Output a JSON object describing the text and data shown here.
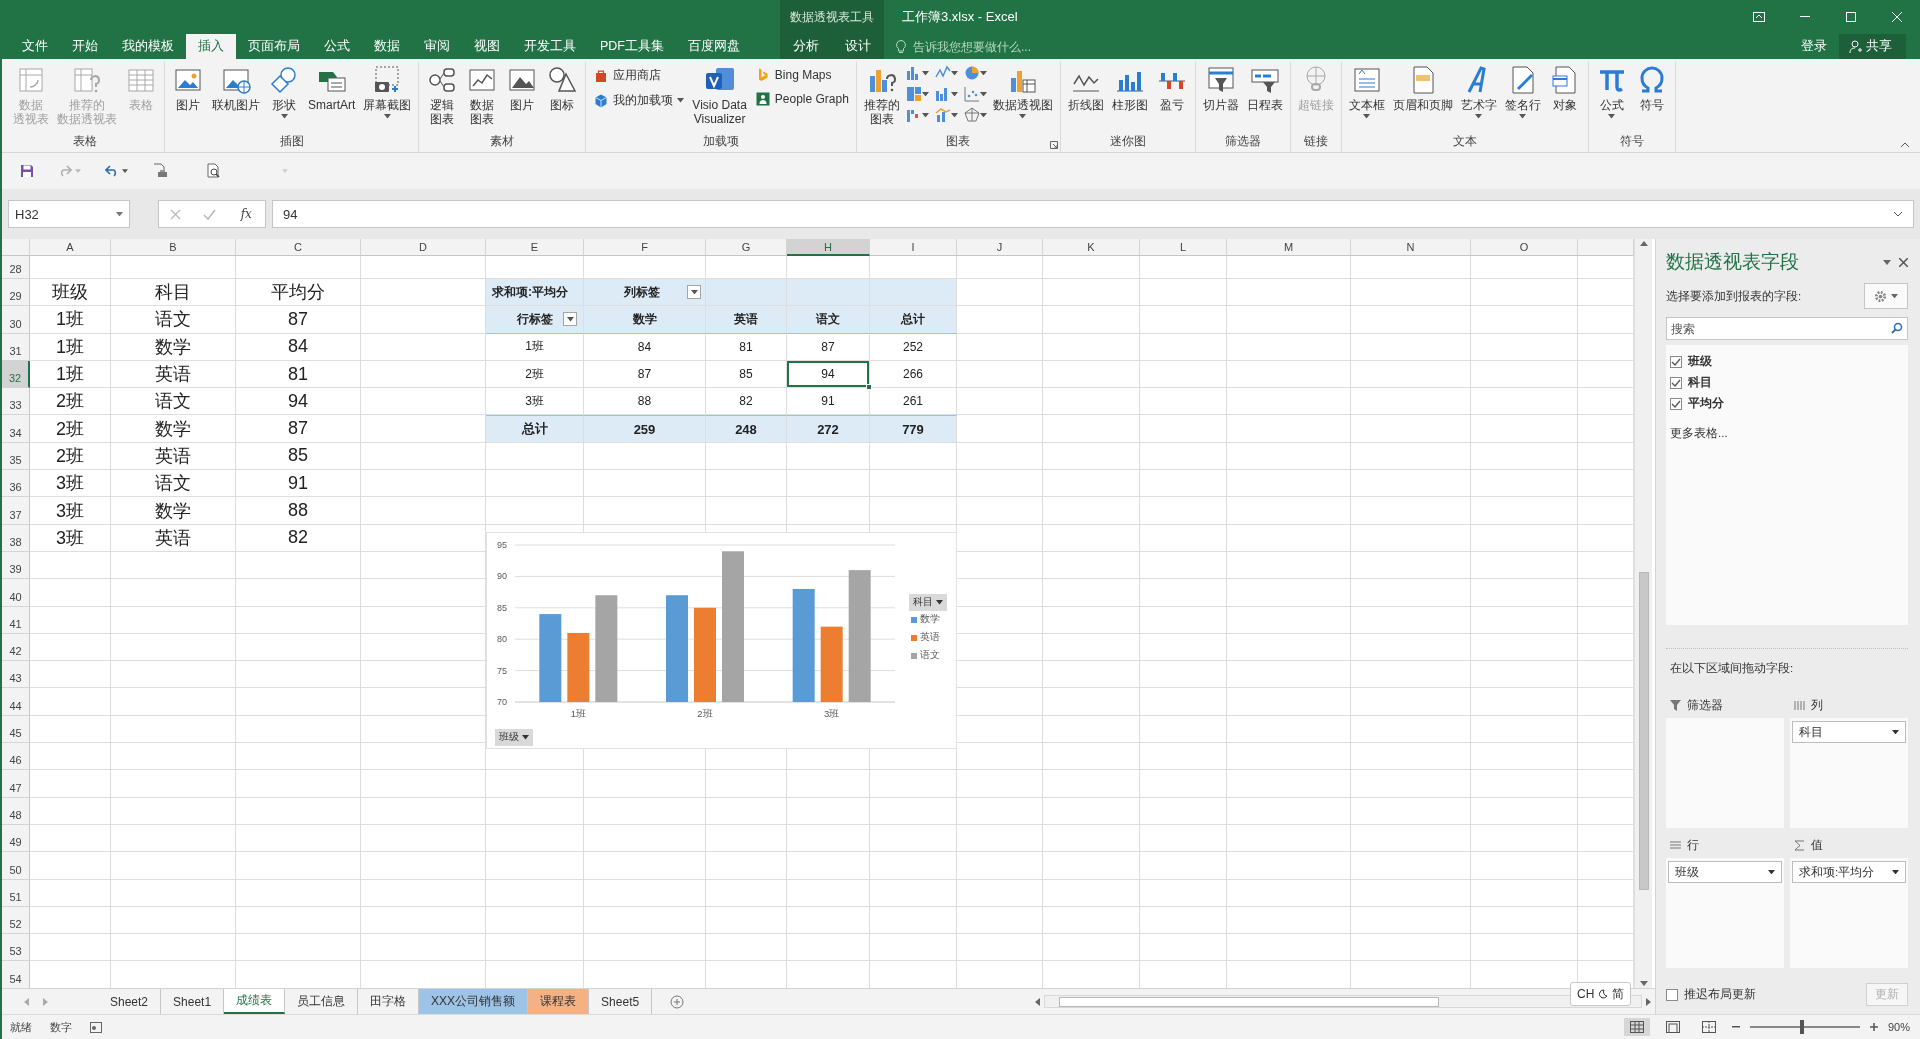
{
  "title_bar": {
    "context_label": "数据透视表工具",
    "title": "工作簿3.xlsx - Excel"
  },
  "menu_tabs": [
    {
      "label": "文件",
      "selected": false,
      "kind": "normal"
    },
    {
      "label": "开始",
      "selected": false,
      "kind": "normal"
    },
    {
      "label": "我的模板",
      "selected": false,
      "kind": "normal"
    },
    {
      "label": "插入",
      "selected": true,
      "kind": "normal"
    },
    {
      "label": "页面布局",
      "selected": false,
      "kind": "normal"
    },
    {
      "label": "公式",
      "selected": false,
      "kind": "normal"
    },
    {
      "label": "数据",
      "selected": false,
      "kind": "normal"
    },
    {
      "label": "审阅",
      "selected": false,
      "kind": "normal"
    },
    {
      "label": "视图",
      "selected": false,
      "kind": "normal"
    },
    {
      "label": "开发工具",
      "selected": false,
      "kind": "normal"
    },
    {
      "label": "PDF工具集",
      "selected": false,
      "kind": "normal"
    },
    {
      "label": "百度网盘",
      "selected": false,
      "kind": "normal"
    },
    {
      "label": "分析",
      "selected": false,
      "kind": "context"
    },
    {
      "label": "设计",
      "selected": false,
      "kind": "context"
    }
  ],
  "tell_me": {
    "placeholder": "告诉我您想要做什么..."
  },
  "account": {
    "login": "登录",
    "share": "共享"
  },
  "ribbon_groups": [
    {
      "label": "表格",
      "launcher": false,
      "items": [
        {
          "kind": "large",
          "lines": [
            "数据",
            "透视表"
          ],
          "disabled": true,
          "dropdown": false
        },
        {
          "kind": "large",
          "lines": [
            "推荐的",
            "数据透视表"
          ],
          "disabled": true,
          "dropdown": false
        },
        {
          "kind": "large",
          "lines": [
            "表格"
          ],
          "disabled": true,
          "dropdown": false
        }
      ]
    },
    {
      "label": "插图",
      "launcher": false,
      "items": [
        {
          "kind": "large",
          "lines": [
            "图片"
          ],
          "disabled": false,
          "dropdown": false
        },
        {
          "kind": "large",
          "lines": [
            "联机图片"
          ],
          "disabled": false,
          "dropdown": false
        },
        {
          "kind": "large",
          "lines": [
            "形状"
          ],
          "disabled": false,
          "dropdown": true
        },
        {
          "kind": "large",
          "lines": [
            "SmartArt"
          ],
          "disabled": false,
          "dropdown": false
        },
        {
          "kind": "large",
          "lines": [
            "屏幕截图"
          ],
          "disabled": false,
          "dropdown": true
        }
      ]
    },
    {
      "label": "素材",
      "launcher": false,
      "items": [
        {
          "kind": "large",
          "lines": [
            "逻辑",
            "图表"
          ],
          "disabled": false,
          "dropdown": false
        },
        {
          "kind": "large",
          "lines": [
            "数据",
            "图表"
          ],
          "disabled": false,
          "dropdown": false
        },
        {
          "kind": "large",
          "lines": [
            "图片"
          ],
          "disabled": false,
          "dropdown": false
        },
        {
          "kind": "large",
          "lines": [
            "图标"
          ],
          "disabled": false,
          "dropdown": false
        }
      ]
    },
    {
      "label": "加载项",
      "launcher": false,
      "items": [
        {
          "kind": "small",
          "lines": [
            "应用商店"
          ],
          "disabled": false,
          "dropdown": false
        },
        {
          "kind": "small",
          "lines": [
            "我的加载项"
          ],
          "disabled": false,
          "dropdown": true
        },
        {
          "kind": "large",
          "lines": [
            "Visio Data",
            "Visualizer"
          ],
          "disabled": false,
          "dropdown": false
        },
        {
          "kind": "small",
          "lines": [
            "Bing Maps"
          ],
          "disabled": false,
          "dropdown": false
        },
        {
          "kind": "small",
          "lines": [
            "People Graph"
          ],
          "disabled": false,
          "dropdown": false
        }
      ]
    },
    {
      "label": "图表",
      "launcher": true,
      "items": [
        {
          "kind": "large",
          "lines": [
            "推荐的",
            "图表"
          ],
          "disabled": false,
          "dropdown": false
        },
        {
          "kind": "icon_grid",
          "dropdown": true
        },
        {
          "kind": "large",
          "lines": [
            "数据透视图"
          ],
          "disabled": false,
          "dropdown": true
        }
      ]
    },
    {
      "label": "迷你图",
      "launcher": false,
      "items": [
        {
          "kind": "large",
          "lines": [
            "折线图"
          ],
          "disabled": false,
          "dropdown": false
        },
        {
          "kind": "large",
          "lines": [
            "柱形图"
          ],
          "disabled": false,
          "dropdown": false
        },
        {
          "kind": "large",
          "lines": [
            "盈亏"
          ],
          "disabled": false,
          "dropdown": false
        }
      ]
    },
    {
      "label": "筛选器",
      "launcher": false,
      "items": [
        {
          "kind": "large",
          "lines": [
            "切片器"
          ],
          "disabled": false,
          "dropdown": false
        },
        {
          "kind": "large",
          "lines": [
            "日程表"
          ],
          "disabled": false,
          "dropdown": false
        }
      ]
    },
    {
      "label": "链接",
      "launcher": false,
      "items": [
        {
          "kind": "large",
          "lines": [
            "超链接"
          ],
          "disabled": true,
          "dropdown": false
        }
      ]
    },
    {
      "label": "文本",
      "launcher": false,
      "items": [
        {
          "kind": "large",
          "lines": [
            "文本框"
          ],
          "disabled": false,
          "dropdown": true
        },
        {
          "kind": "large",
          "lines": [
            "页眉和页脚"
          ],
          "disabled": false,
          "dropdown": false
        },
        {
          "kind": "large",
          "lines": [
            "艺术字"
          ],
          "disabled": false,
          "dropdown": true
        },
        {
          "kind": "large",
          "lines": [
            "签名行"
          ],
          "disabled": false,
          "dropdown": true
        },
        {
          "kind": "large",
          "lines": [
            "对象"
          ],
          "disabled": false,
          "dropdown": false
        }
      ]
    },
    {
      "label": "符号",
      "launcher": false,
      "items": [
        {
          "kind": "large",
          "lines": [
            "公式"
          ],
          "disabled": false,
          "dropdown": true
        },
        {
          "kind": "large",
          "lines": [
            "符号"
          ],
          "disabled": false,
          "dropdown": false
        }
      ]
    }
  ],
  "formula_bar": {
    "name_box": "H32",
    "function_label": "fx",
    "value": "94"
  },
  "columns": [
    {
      "label": "A",
      "selected": false
    },
    {
      "label": "B",
      "selected": false
    },
    {
      "label": "C",
      "selected": false
    },
    {
      "label": "D",
      "selected": false
    },
    {
      "label": "E",
      "selected": false
    },
    {
      "label": "F",
      "selected": false
    },
    {
      "label": "G",
      "selected": false
    },
    {
      "label": "H",
      "selected": true
    },
    {
      "label": "I",
      "selected": false
    },
    {
      "label": "J",
      "selected": false
    },
    {
      "label": "K",
      "selected": false
    },
    {
      "label": "L",
      "selected": false
    },
    {
      "label": "M",
      "selected": false
    },
    {
      "label": "N",
      "selected": false
    },
    {
      "label": "O",
      "selected": false
    }
  ],
  "rows": [
    {
      "label": "28",
      "selected": false
    },
    {
      "label": "29",
      "selected": false
    },
    {
      "label": "30",
      "selected": false
    },
    {
      "label": "31",
      "selected": false
    },
    {
      "label": "32",
      "selected": true
    },
    {
      "label": "33",
      "selected": false
    },
    {
      "label": "34",
      "selected": false
    },
    {
      "label": "35",
      "selected": false
    },
    {
      "label": "36",
      "selected": false
    },
    {
      "label": "37",
      "selected": false
    },
    {
      "label": "38",
      "selected": false
    },
    {
      "label": "39",
      "selected": false
    },
    {
      "label": "40",
      "selected": false
    },
    {
      "label": "41",
      "selected": false
    },
    {
      "label": "42",
      "selected": false
    },
    {
      "label": "43",
      "selected": false
    },
    {
      "label": "44",
      "selected": false
    },
    {
      "label": "45",
      "selected": false
    },
    {
      "label": "46",
      "selected": false
    },
    {
      "label": "47",
      "selected": false
    },
    {
      "label": "48",
      "selected": false
    },
    {
      "label": "49",
      "selected": false
    },
    {
      "label": "50",
      "selected": false
    },
    {
      "label": "51",
      "selected": false
    },
    {
      "label": "52",
      "selected": false
    },
    {
      "label": "53",
      "selected": false
    },
    {
      "label": "54",
      "selected": false
    }
  ],
  "data_table": [
    [
      "班级",
      "科目",
      "平均分"
    ],
    [
      "1班",
      "语文",
      "87"
    ],
    [
      "1班",
      "数学",
      "84"
    ],
    [
      "1班",
      "英语",
      "81"
    ],
    [
      "2班",
      "语文",
      "94"
    ],
    [
      "2班",
      "数学",
      "87"
    ],
    [
      "2班",
      "英语",
      "85"
    ],
    [
      "3班",
      "语文",
      "91"
    ],
    [
      "3班",
      "数学",
      "88"
    ],
    [
      "3班",
      "英语",
      "82"
    ]
  ],
  "pivot": {
    "value_field": "求和项:平均分",
    "column_label": "列标签",
    "row_label": "行标签",
    "columns": [
      "数学",
      "英语",
      "语文",
      "总计"
    ],
    "rows": [
      {
        "label": "1班",
        "values": [
          "84",
          "81",
          "87",
          "252"
        ]
      },
      {
        "label": "2班",
        "values": [
          "87",
          "85",
          "94",
          "266"
        ]
      },
      {
        "label": "3班",
        "values": [
          "88",
          "82",
          "91",
          "261"
        ]
      }
    ],
    "total": {
      "label": "总计",
      "values": [
        "259",
        "248",
        "272",
        "779"
      ]
    }
  },
  "chart": {
    "legend_field": "科目",
    "axis_field": "班级",
    "chart_data": {
      "type": "bar",
      "categories": [
        "1班",
        "2班",
        "3班"
      ],
      "series": [
        {
          "name": "数学",
          "color": "#5b9bd5",
          "values": [
            84,
            87,
            88
          ]
        },
        {
          "name": "英语",
          "color": "#ed7d31",
          "values": [
            81,
            85,
            82
          ]
        },
        {
          "name": "语文",
          "color": "#a5a5a5",
          "values": [
            87,
            94,
            91
          ]
        }
      ],
      "ylim": [
        70,
        95
      ],
      "yticks": [
        70,
        75,
        80,
        85,
        90,
        95
      ],
      "grid": true,
      "legend": "right"
    }
  },
  "sheet_tabs": [
    {
      "label": "Sheet2",
      "selected": false
    },
    {
      "label": "Sheet1",
      "selected": false
    },
    {
      "label": "成绩表",
      "selected": true
    },
    {
      "label": "员工信息",
      "selected": false
    },
    {
      "label": "田字格",
      "selected": false
    },
    {
      "label": "XXX公司销售额",
      "selected": false,
      "color": "#9dc3e6"
    },
    {
      "label": "课程表",
      "selected": false,
      "color": "#f4b183"
    },
    {
      "label": "Sheet5",
      "selected": false
    }
  ],
  "ime": {
    "language": "CH",
    "mode": "简"
  },
  "field_list": {
    "title": "数据透视表字段",
    "prompt": "选择要添加到报表的字段:",
    "search": {
      "placeholder": "搜索"
    },
    "fields": [
      {
        "label": "班级",
        "checked": true
      },
      {
        "label": "科目",
        "checked": true
      },
      {
        "label": "平均分",
        "checked": true
      }
    ],
    "more_tables": "更多表格...",
    "areas_prompt": "在以下区域间拖动字段:",
    "areas": [
      {
        "kind": "filter",
        "label": "筛选器"
      },
      {
        "kind": "columns",
        "label": "列",
        "items": [
          "科目"
        ]
      },
      {
        "kind": "rows",
        "label": "行",
        "items": [
          "班级"
        ]
      },
      {
        "kind": "values",
        "label": "值",
        "items": [
          "求和项:平均分"
        ]
      }
    ],
    "defer_update": {
      "label": "推迟布局更新",
      "checked": false
    },
    "update_button": {
      "label": "更新",
      "disabled": true
    }
  },
  "status_bar": {
    "ready": "就绪",
    "mode": "数字",
    "views": [
      {
        "kind": "normal",
        "selected": true
      },
      {
        "kind": "page_layout",
        "selected": false
      },
      {
        "kind": "page_break",
        "selected": false
      }
    ],
    "zoom": {
      "level": 0.47,
      "reading": "90%"
    }
  }
}
